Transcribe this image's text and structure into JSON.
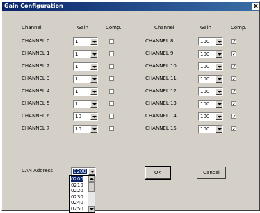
{
  "window": {
    "title": "Gain Configuration",
    "close_glyph": "x"
  },
  "headers": {
    "channel": "Channel",
    "gain": "Gain",
    "comp": "Comp."
  },
  "left_channels": [
    {
      "name": "CHANNEL 0",
      "gain": "1",
      "comp": false
    },
    {
      "name": "CHANNEL 1",
      "gain": "1",
      "comp": false
    },
    {
      "name": "CHANNEL 2",
      "gain": "1",
      "comp": false
    },
    {
      "name": "CHANNEL 3",
      "gain": "1",
      "comp": false
    },
    {
      "name": "CHANNEL 4",
      "gain": "1",
      "comp": false
    },
    {
      "name": "CHANNEL 5",
      "gain": "1",
      "comp": false
    },
    {
      "name": "CHANNEL 6",
      "gain": "10",
      "comp": false
    },
    {
      "name": "CHANNEL 7",
      "gain": "10",
      "comp": false
    }
  ],
  "right_channels": [
    {
      "name": "CHANNEL 8",
      "gain": "100",
      "comp": true
    },
    {
      "name": "CHANNEL 9",
      "gain": "100",
      "comp": true
    },
    {
      "name": "CHANNEL 10",
      "gain": "100",
      "comp": true
    },
    {
      "name": "CHANNEL 11",
      "gain": "100",
      "comp": true
    },
    {
      "name": "CHANNEL 12",
      "gain": "100",
      "comp": true
    },
    {
      "name": "CHANNEL 13",
      "gain": "100",
      "comp": true
    },
    {
      "name": "CHANNEL 14",
      "gain": "100",
      "comp": true
    },
    {
      "name": "CHANNEL 15",
      "gain": "100",
      "comp": true
    }
  ],
  "can": {
    "label": "CAN Address",
    "selected": "0200",
    "options": [
      "0200",
      "0210",
      "0220",
      "0230",
      "0240",
      "0250"
    ]
  },
  "buttons": {
    "ok": "OK",
    "cancel": "Cancel"
  },
  "check_glyph": "✓"
}
